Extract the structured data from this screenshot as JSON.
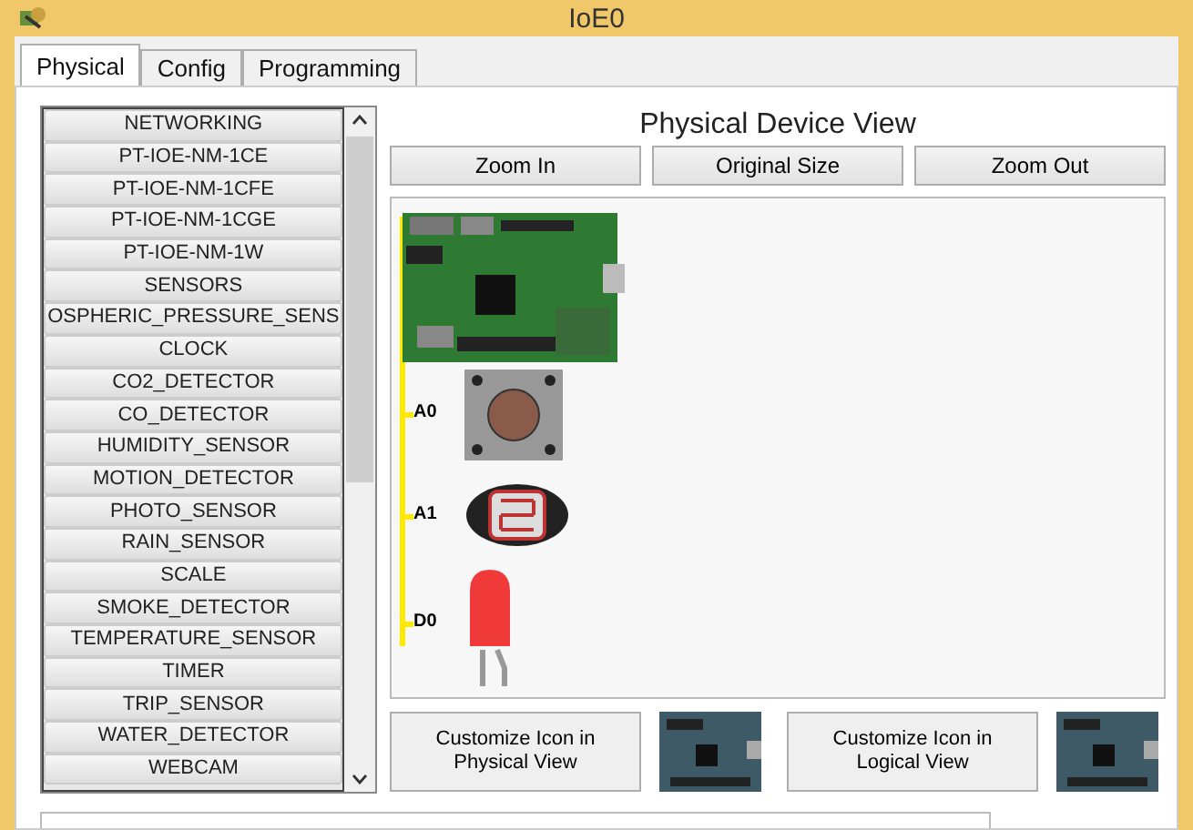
{
  "window": {
    "title": "IoE0"
  },
  "tabs": [
    {
      "label": "Physical",
      "selected": true
    },
    {
      "label": "Config",
      "selected": false
    },
    {
      "label": "Programming",
      "selected": false
    }
  ],
  "component_list": [
    "NETWORKING",
    "PT-IOE-NM-1CE",
    "PT-IOE-NM-1CFE",
    "PT-IOE-NM-1CGE",
    "PT-IOE-NM-1W",
    "SENSORS",
    "OSPHERIC_PRESSURE_SENS",
    "CLOCK",
    "CO2_DETECTOR",
    "CO_DETECTOR",
    "HUMIDITY_SENSOR",
    "MOTION_DETECTOR",
    "PHOTO_SENSOR",
    "RAIN_SENSOR",
    "SCALE",
    "SMOKE_DETECTOR",
    "TEMPERATURE_SENSOR",
    "TIMER",
    "TRIP_SENSOR",
    "WATER_DETECTOR",
    "WEBCAM"
  ],
  "device_view": {
    "title": "Physical Device View",
    "zoom_buttons": [
      "Zoom In",
      "Original Size",
      "Zoom Out"
    ],
    "pins": [
      {
        "label": "A0",
        "kind": "button"
      },
      {
        "label": "A1",
        "kind": "photo"
      },
      {
        "label": "D0",
        "kind": "led"
      }
    ]
  },
  "customize_buttons": [
    "Customize Icon in Physical View",
    "Customize Icon in Logical View"
  ]
}
